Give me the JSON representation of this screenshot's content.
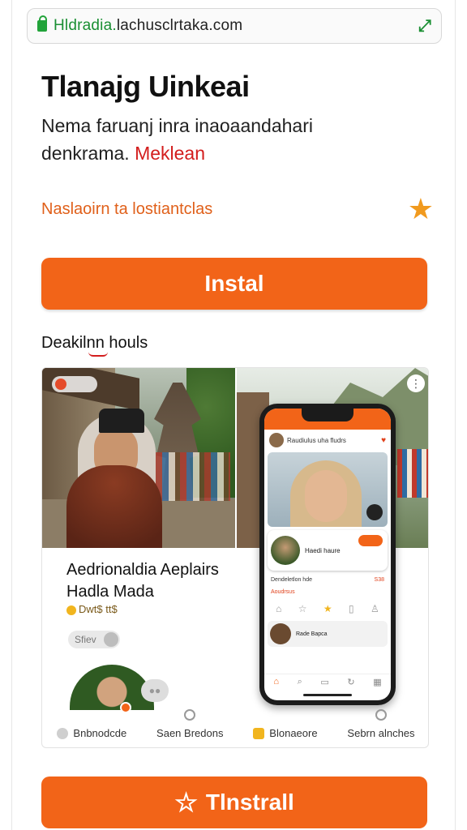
{
  "browser": {
    "url_prefix": "Hldradia.",
    "url_rest": "lachusclrtaka.com"
  },
  "app": {
    "title": "Tlanajg Uinkeai",
    "description_line1": "Nema faruanj inra inaoaandahari",
    "description_line2_prefix": "denkrama.",
    "description_line2_highlight": "Meklean",
    "rating_text": "Naslaoirn ta lostiantclas",
    "install_label": "Instal",
    "section_label": "Deakilnn houls"
  },
  "gallery": {
    "card_title": "Aedrionaldia Aeplairs Hadla Mada",
    "card_meta": "Dwt$ tt$",
    "chip_label": "Sfiev",
    "phone": {
      "header_text": "Raudiulus uha fludrs",
      "card_name": "Haedi haure",
      "row_label": "Dendeletlon hde",
      "row_value": "S38",
      "row_sub": "Aoudrsus",
      "list_text": "Rade Bapca"
    },
    "tabs": [
      {
        "label": "Bnbnodcde"
      },
      {
        "label": "Saen Bredons"
      },
      {
        "label": "Blonaeore"
      },
      {
        "label": "Sebrn alnches"
      }
    ]
  },
  "footer": {
    "install_label": "Tlnstrall"
  },
  "colors": {
    "accent": "#f26418",
    "star": "#f19a1e",
    "url_green": "#1a8f33",
    "highlight_red": "#d31d1d"
  }
}
